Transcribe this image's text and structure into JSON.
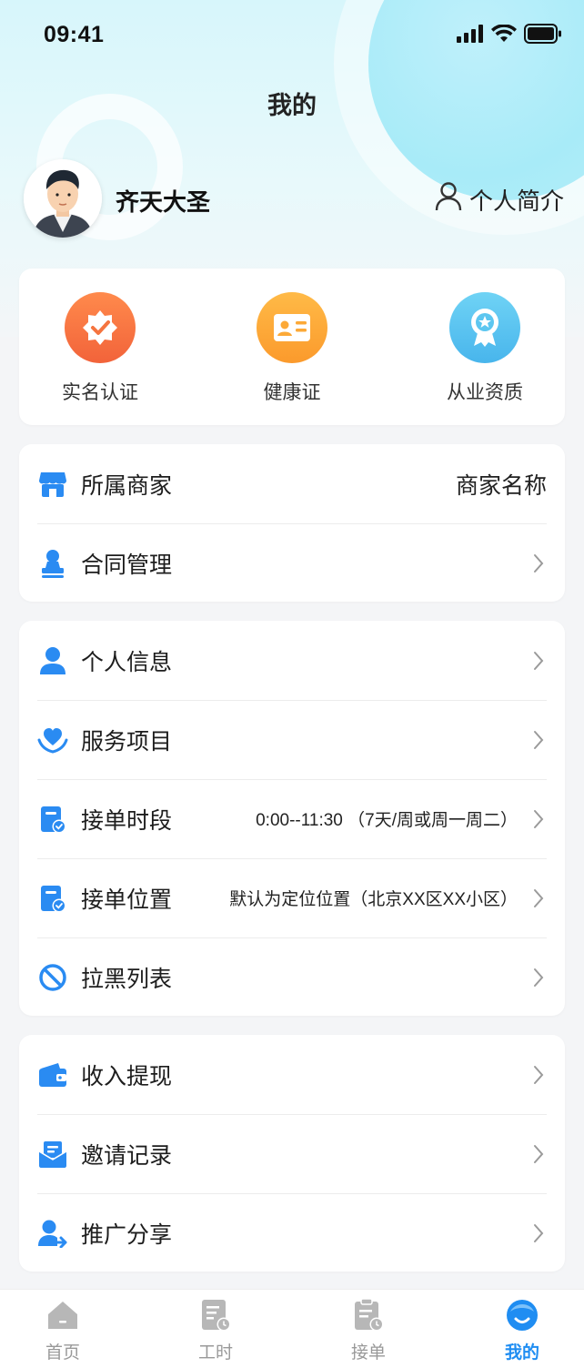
{
  "status": {
    "time": "09:41"
  },
  "header": {
    "title": "我的"
  },
  "user": {
    "name": "齐天大圣",
    "profile_link": "个人简介"
  },
  "certs": [
    {
      "label": "实名认证",
      "icon": "verified-badge-icon",
      "color": "#f5743f"
    },
    {
      "label": "健康证",
      "icon": "id-card-icon",
      "color": "#fda938"
    },
    {
      "label": "从业资质",
      "icon": "award-medal-icon",
      "color": "#5cc6f0"
    }
  ],
  "merchant_group": {
    "items": [
      {
        "label": "所属商家",
        "value": "商家名称",
        "icon": "store-icon"
      },
      {
        "label": "合同管理",
        "value": "",
        "icon": "stamp-icon"
      }
    ]
  },
  "info_group": {
    "items": [
      {
        "label": "个人信息",
        "value": "",
        "icon": "user-icon"
      },
      {
        "label": "服务项目",
        "value": "",
        "icon": "heart-hands-icon"
      },
      {
        "label": "接单时段",
        "value": "0:00--11:30 （7天/周或周一周二）",
        "icon": "clipboard-check-icon"
      },
      {
        "label": "接单位置",
        "value": "默认为定位位置（北京XX区XX小区）",
        "icon": "clipboard-check-icon"
      },
      {
        "label": "拉黑列表",
        "value": "",
        "icon": "block-icon"
      }
    ]
  },
  "finance_group": {
    "items": [
      {
        "label": "收入提现",
        "value": "",
        "icon": "wallet-icon"
      },
      {
        "label": "邀请记录",
        "value": "",
        "icon": "envelope-icon"
      },
      {
        "label": "推广分享",
        "value": "",
        "icon": "user-share-icon"
      }
    ]
  },
  "tabs": [
    {
      "label": "首页",
      "icon": "home-icon",
      "active": false
    },
    {
      "label": "工时",
      "icon": "timesheet-icon",
      "active": false
    },
    {
      "label": "接单",
      "icon": "order-clipboard-icon",
      "active": false
    },
    {
      "label": "我的",
      "icon": "profile-face-icon",
      "active": true
    }
  ],
  "colors": {
    "accent": "#1f8df2",
    "icon_blue": "#2a8bf2",
    "tab_inactive": "#999999"
  }
}
